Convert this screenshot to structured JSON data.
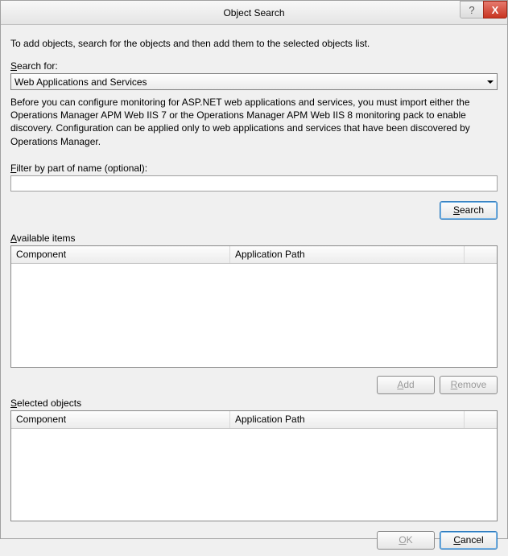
{
  "titlebar": {
    "title": "Object Search",
    "help": "?",
    "close": "X"
  },
  "instruction": "To add objects, search for the objects and then add them to the selected objects list.",
  "search_for_label_pre": "S",
  "search_for_label_post": "earch for:",
  "search_for_value": "Web Applications and Services",
  "description": "Before you can configure monitoring for ASP.NET web applications and services, you must import either the Operations Manager APM Web IIS 7 or the Operations Manager APM Web IIS 8 monitoring pack to enable discovery. Configuration can be applied only to web applications and services that have been discovered by Operations Manager.",
  "filter_label_pre": "F",
  "filter_label_post": "ilter by part of name (optional):",
  "filter_value": "",
  "search_button_pre": "S",
  "search_button_post": "earch",
  "available_label_pre": "A",
  "available_label_post": "vailable items",
  "columns": {
    "component": "Component",
    "app_path": "Application Path"
  },
  "add_button_pre": "A",
  "add_button_post": "dd",
  "remove_button_pre": "R",
  "remove_button_post": "emove",
  "selected_label_pre": "S",
  "selected_label_post": "elected objects",
  "ok_button_pre": "O",
  "ok_button_post": "K",
  "cancel_button_pre": "C",
  "cancel_button_post": "ancel"
}
